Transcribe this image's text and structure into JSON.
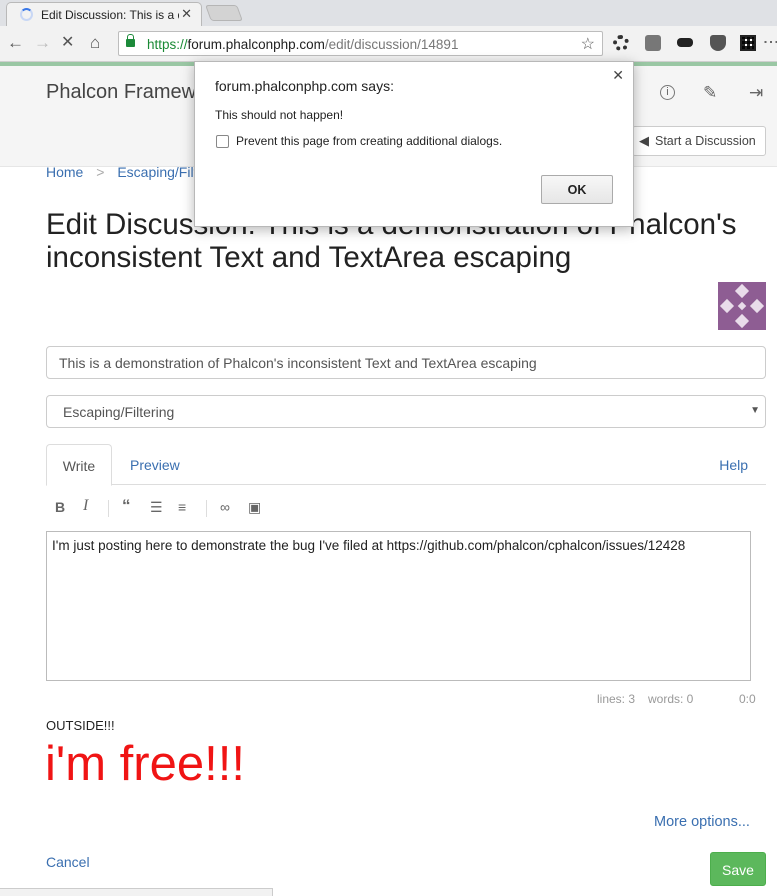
{
  "browser": {
    "tab_title": "Edit Discussion: This is a d",
    "tab_close": "✕",
    "url_scheme": "https://",
    "url_host": "forum.phalconphp.com",
    "url_path": "/edit/discussion/14891"
  },
  "site": {
    "brand": "Phalcon Framew",
    "start_discussion_label": "Start a Discussion"
  },
  "breadcrumb": {
    "home": "Home",
    "separator": ">",
    "category": "Escaping/Filte"
  },
  "page": {
    "title": "Edit Discussion: This is a demonstration of Phalcon's inconsistent Text and TextArea escaping"
  },
  "form": {
    "title_value": "This is a demonstration of Phalcon's inconsistent Text and TextArea escaping",
    "category_value": "Escaping/Filtering",
    "tabs": {
      "write": "Write",
      "preview": "Preview",
      "help": "Help"
    },
    "editor_content": "I'm just posting here to demonstrate the bug I've filed at https://github.com/phalcon/cphalcon/issues/12428",
    "status": {
      "lines": "lines: 3",
      "words": "words: 0",
      "cursor": "0:0"
    },
    "more_options": "More options...",
    "cancel": "Cancel",
    "save": "Save"
  },
  "injected": {
    "outside_text": "OUTSIDE!!!",
    "free_text": "i'm free!!!",
    "free_color": "#f01414"
  },
  "dialog": {
    "host": "forum.phalconphp.com says:",
    "message": "This should not happen!",
    "checkbox_label": "Prevent this page from creating additional dialogs.",
    "ok": "OK"
  },
  "colors": {
    "link": "#3a6fb0",
    "save_button": "#5cb85c",
    "avatar": "#8e5d93",
    "accent_bar": "#9ac7a4"
  }
}
